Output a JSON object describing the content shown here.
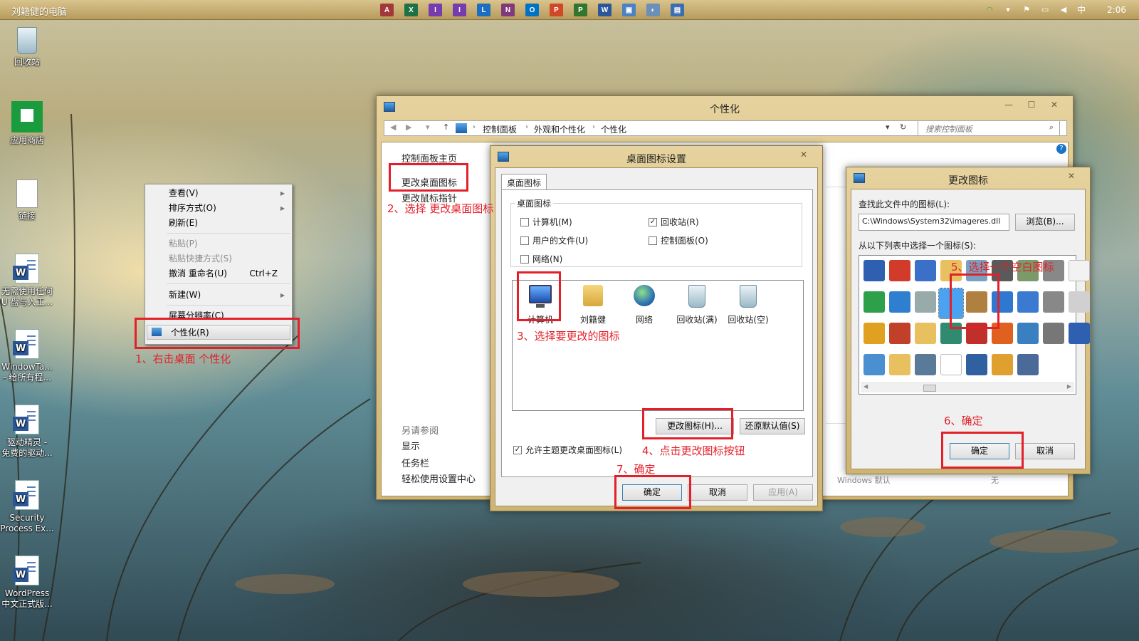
{
  "topbar": {
    "title": "刘籍健的电脑",
    "apps": [
      {
        "name": "access-app-icon",
        "glyph": "A",
        "color": "#a4373a"
      },
      {
        "name": "excel-app-icon",
        "glyph": "X",
        "color": "#1e7145"
      },
      {
        "name": "infopath-app-icon",
        "glyph": "I",
        "color": "#773bb0"
      },
      {
        "name": "infopath-filler-app-icon",
        "glyph": "I",
        "color": "#773bb0"
      },
      {
        "name": "lync-app-icon",
        "glyph": "L",
        "color": "#1b6ec2"
      },
      {
        "name": "onenote-app-icon",
        "glyph": "N",
        "color": "#80397b"
      },
      {
        "name": "outlook-app-icon",
        "glyph": "O",
        "color": "#0072c6"
      },
      {
        "name": "powerpoint-app-icon",
        "glyph": "P",
        "color": "#d24726"
      },
      {
        "name": "project-app-icon",
        "glyph": "P",
        "color": "#31752f"
      },
      {
        "name": "word-app-icon",
        "glyph": "W",
        "color": "#2b579a"
      },
      {
        "name": "remote-desktop-app-icon",
        "glyph": "▣",
        "color": "#4a82c3"
      },
      {
        "name": "control-panel-app-icon",
        "glyph": "◐",
        "color": "#6a8fb8"
      },
      {
        "name": "personalization-app-icon",
        "glyph": "▤",
        "color": "#3b6eb0"
      }
    ],
    "tray": {
      "time": "2:06",
      "ime": "中"
    }
  },
  "desktop": {
    "icons": [
      {
        "label": "回收站"
      },
      {
        "label": "应用商店"
      },
      {
        "label": "链接"
      },
      {
        "label": "无需使用任何\nU 盘与入工..."
      },
      {
        "label": "WindowTa...\n- 给所有程..."
      },
      {
        "label": "驱动精灵 -\n免费的驱动..."
      },
      {
        "label": "Security\nProcess Ex..."
      },
      {
        "label": "WordPress\n中文正式版..."
      }
    ]
  },
  "context_menu": {
    "view": "查看(V)",
    "sort": "排序方式(O)",
    "refresh": "刷新(E)",
    "paste": "粘贴(P)",
    "paste_shortcut": "粘贴快捷方式(S)",
    "undo": "撤消 重命名(U)",
    "undo_shortcut": "Ctrl+Z",
    "new": "新建(W)",
    "screen_res": "屏幕分辨率(C)",
    "personalize": "个性化(R)"
  },
  "personalization": {
    "title": "个性化",
    "breadcrumb": [
      "控制面板",
      "外观和个性化",
      "个性化"
    ],
    "search_placeholder": "搜索控制面板",
    "left_home": "控制面板主页",
    "left_change_icons": "更改桌面图标",
    "left_change_pointer": "更改鼠标指针",
    "see_also": "另请参阅",
    "see_display": "显示",
    "see_taskbar": "任务栏",
    "see_ease": "轻松使用设置中心",
    "windows_default": "Windows 默认",
    "none": "无"
  },
  "desktop_icon_settings": {
    "title": "桌面图标设置",
    "tab": "桌面图标",
    "group_label": "桌面图标",
    "checks": [
      {
        "label": "计算机(M)",
        "checked": false
      },
      {
        "label": "回收站(R)",
        "checked": true
      },
      {
        "label": "用户的文件(U)",
        "checked": false
      },
      {
        "label": "控制面板(O)",
        "checked": false
      },
      {
        "label": "网络(N)",
        "checked": false
      }
    ],
    "icons": [
      "计算机",
      "刘籍健",
      "网络",
      "回收站(满)",
      "回收站(空)"
    ],
    "change_icon": "更改图标(H)...",
    "restore_default": "还原默认值(S)",
    "allow_themes": "允许主题更改桌面图标(L)",
    "allow_themes_checked": true,
    "ok": "确定",
    "cancel": "取消",
    "apply": "应用(A)"
  },
  "change_icon": {
    "title": "更改图标",
    "file_label": "查找此文件中的图标(L):",
    "file_value": "C:\\Windows\\System32\\imageres.dll",
    "browse": "浏览(B)...",
    "list_label": "从以下列表中选择一个图标(S):",
    "ok": "确定",
    "cancel": "取消"
  },
  "annotations": {
    "n1": "1、右击桌面 个性化",
    "n2": "2、选择 更改桌面图标",
    "n3": "3、选择要更改的图标",
    "n4": "4、点击更改图标按钮",
    "n5": "5、选择一个空白图标",
    "n6": "6、确定",
    "n7": "7、确定"
  }
}
